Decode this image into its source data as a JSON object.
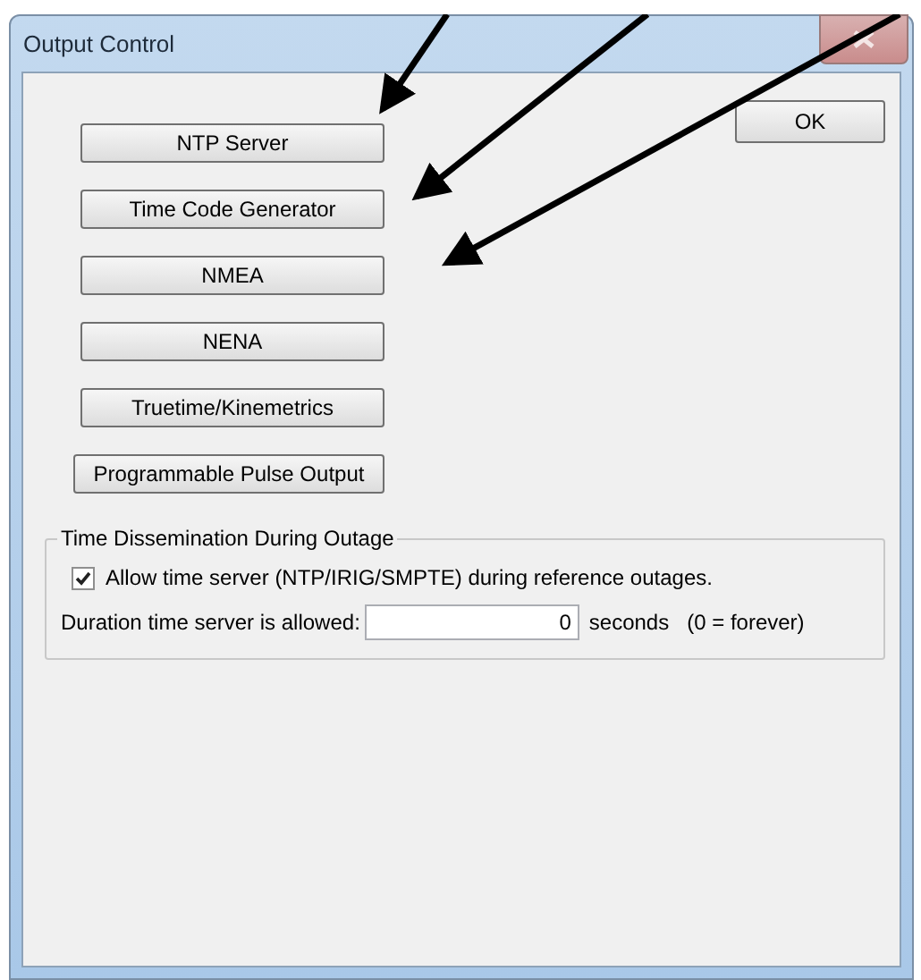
{
  "window": {
    "title": "Output Control"
  },
  "buttons": [
    "NTP Server",
    "Time Code Generator",
    "NMEA",
    "NENA",
    "Truetime/Kinemetrics",
    "Programmable Pulse Output"
  ],
  "ok_button": "OK",
  "group": {
    "title": "Time Dissemination During Outage",
    "checkbox": {
      "label": "Allow time server (NTP/IRIG/SMPTE) during reference outages.",
      "checked": true
    },
    "duration": {
      "label": "Duration time server is allowed:",
      "value": "0",
      "unit": "seconds",
      "hint": "(0 = forever)"
    }
  }
}
